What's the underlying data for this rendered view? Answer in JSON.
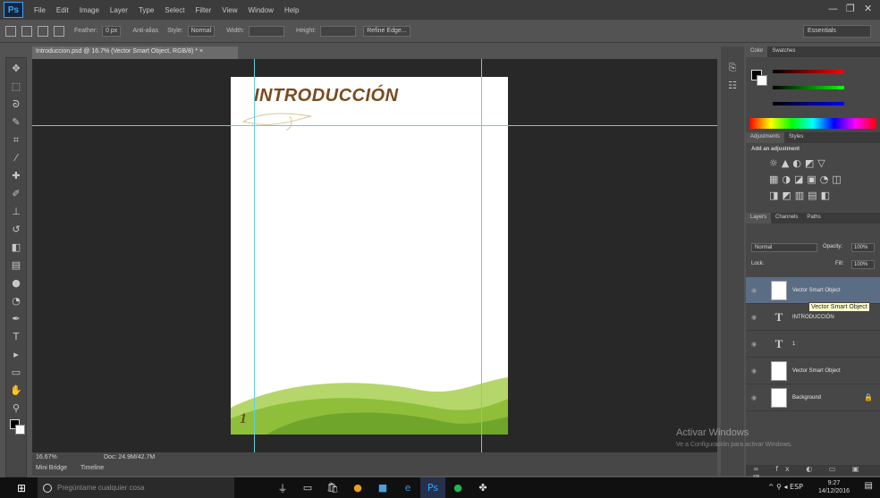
{
  "app": {
    "logo": "Ps",
    "menu": [
      "File",
      "Edit",
      "Image",
      "Layer",
      "Type",
      "Select",
      "Filter",
      "View",
      "Window",
      "Help"
    ],
    "window_controls": [
      "—",
      "❐",
      "✕"
    ]
  },
  "options_bar": {
    "feather_label": "Feather:",
    "feather_value": "0 px",
    "anti_alias": "Anti-alias",
    "style_label": "Style:",
    "style_value": "Normal",
    "width_label": "Width:",
    "height_label": "Height:",
    "refine_edge": "Refine Edge...",
    "workspace": "Essentials"
  },
  "document": {
    "tab_title": "Introduccion.psd @ 16.7% (Vector Smart Object, RGB/8) * ×",
    "heading": "INTRODUCCIÓN",
    "page_number": "1"
  },
  "status": {
    "zoom": "16.67%",
    "doc_size": "Doc: 24.9M/42.7M",
    "mini_bridge": "Mini Bridge",
    "timeline": "Timeline"
  },
  "panels": {
    "color_tabs": [
      "Color",
      "Swatches"
    ],
    "adjust_tabs": [
      "Adjustments",
      "Styles"
    ],
    "adjust_title": "Add an adjustment",
    "layers_tabs": [
      "Layers",
      "Channels",
      "Paths"
    ],
    "blend_mode": "Normal",
    "opacity_label": "Opacity:",
    "opacity_value": "100%",
    "fill_label": "Fill:",
    "fill_value": "100%",
    "lock_label": "Lock:",
    "layers": [
      {
        "name": "Vector Smart Object",
        "kind": "smart",
        "selected": true
      },
      {
        "name": "INTRODUCCIÓN",
        "kind": "text",
        "selected": false
      },
      {
        "name": "1",
        "kind": "text",
        "selected": false
      },
      {
        "name": "Vector Smart Object",
        "kind": "smart",
        "selected": false
      },
      {
        "name": "Background",
        "kind": "background",
        "selected": false
      }
    ],
    "tooltip": "Vector Smart Object"
  },
  "watermark": {
    "title": "Activar Windows",
    "subtitle": "Ve a Configuración para activar Windows."
  },
  "taskbar": {
    "search_placeholder": "Pregúntame cualquier cosa",
    "time": "9:27",
    "date": "14/12/2016",
    "tray": "^ ⚲ ◂ ESP"
  }
}
